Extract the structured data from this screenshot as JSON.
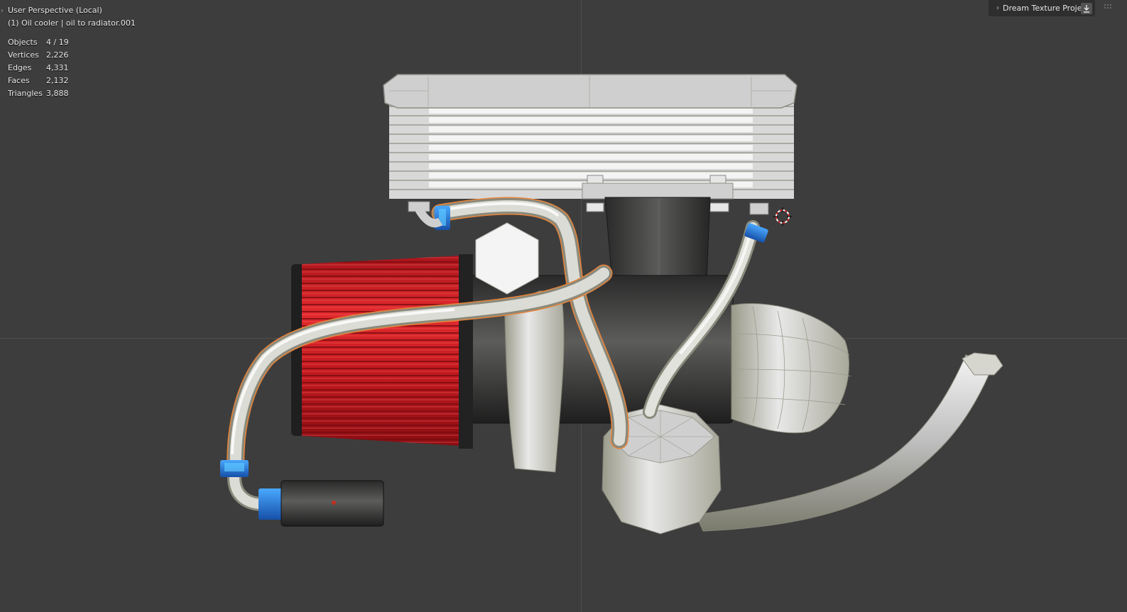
{
  "viewport": {
    "view_name": "User Perspective (Local)",
    "active_object": "(1) Oil cooler | oil to radiator.001"
  },
  "stats": [
    {
      "label": "Objects",
      "value": "4 / 19"
    },
    {
      "label": "Vertices",
      "value": "2,226"
    },
    {
      "label": "Edges",
      "value": "4,331"
    },
    {
      "label": "Faces",
      "value": "2,132"
    },
    {
      "label": "Triangles",
      "value": "3,888"
    }
  ],
  "side_panel": {
    "title": "Dream Texture Projec",
    "expand_icon": "chevron-right-icon",
    "download_icon": "download-icon"
  },
  "colors": {
    "viewport_bg": "#3d3d3d",
    "selection_outline": "#e8843a",
    "filter_red": "#c8181c",
    "fitting_blue": "#1f6fd0"
  }
}
